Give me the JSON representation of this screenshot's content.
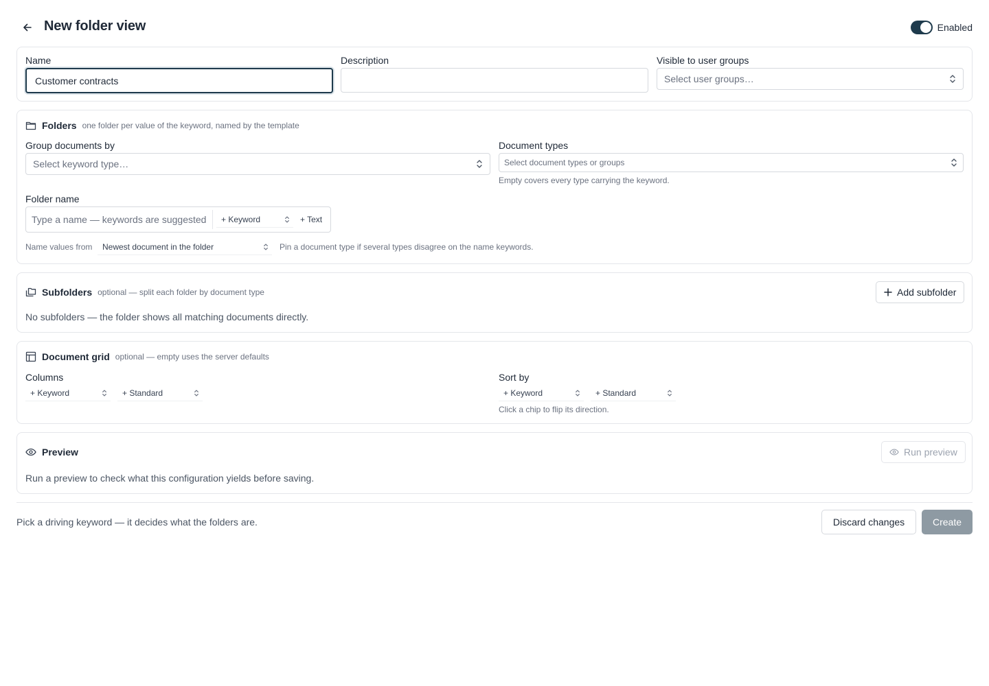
{
  "header": {
    "title": "New folder view",
    "enabled_label": "Enabled",
    "enabled": true
  },
  "basics": {
    "name_label": "Name",
    "name_value": "Customer contracts",
    "description_label": "Description",
    "description_value": "",
    "groups_label": "Visible to user groups",
    "groups_placeholder": "Select user groups…"
  },
  "folders": {
    "title": "Folders",
    "subtitle": "one folder per value of the keyword, named by the template",
    "group_by_label": "Group documents by",
    "group_by_placeholder": "Select keyword type…",
    "doc_types_label": "Document types",
    "doc_types_placeholder": "Select document types or groups",
    "doc_types_hint": "Empty covers every type carrying the keyword.",
    "folder_name_label": "Folder name",
    "folder_name_placeholder": "Type a name — keywords are suggested",
    "add_keyword": "+ Keyword",
    "add_text": "+ Text",
    "name_values_from_label": "Name values from",
    "name_values_from_value": "Newest document in the folder",
    "name_values_hint": "Pin a document type if several types disagree on the name keywords."
  },
  "subfolders": {
    "title": "Subfolders",
    "subtitle": "optional — split each folder by document type",
    "add_button": "Add subfolder",
    "empty_text": "No subfolders — the folder shows all matching documents directly."
  },
  "grid": {
    "title": "Document grid",
    "subtitle": "optional — empty uses the server defaults",
    "columns_label": "Columns",
    "columns_keyword": "+ Keyword",
    "columns_standard": "+ Standard",
    "sort_label": "Sort by",
    "sort_keyword": "+ Keyword",
    "sort_standard": "+ Standard",
    "sort_hint": "Click a chip to flip its direction."
  },
  "preview": {
    "title": "Preview",
    "run_button": "Run preview",
    "body": "Run a preview to check what this configuration yields before saving."
  },
  "footer": {
    "message": "Pick a driving keyword — it decides what the folders are.",
    "discard": "Discard changes",
    "create": "Create"
  },
  "colors": {
    "accent": "#1e3a4c",
    "create_disabled": "#8e9aa3",
    "border": "#e4e6ea"
  },
  "icons": [
    "back-arrow-icon",
    "folder-icon",
    "subfolders-icon",
    "plus-icon",
    "table-icon",
    "eye-icon",
    "chevron-up-down-icon"
  ]
}
